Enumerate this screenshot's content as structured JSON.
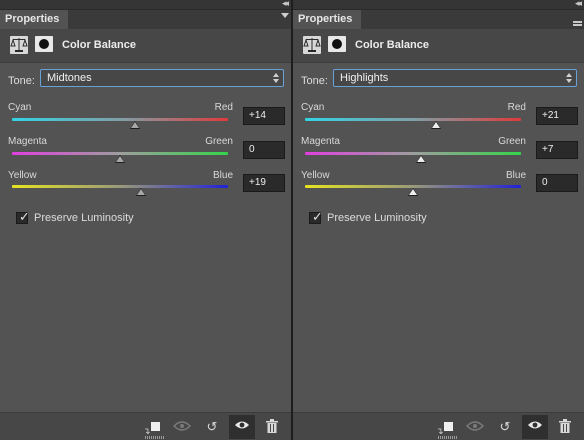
{
  "panels": [
    {
      "tab_label": "Properties",
      "collapse_glyph": "◂◂",
      "title": "Color Balance",
      "tone": {
        "label": "Tone:",
        "value": "Midtones"
      },
      "sliders": [
        {
          "left": "Cyan",
          "right": "Red",
          "value": "+14",
          "level": 14
        },
        {
          "left": "Magenta",
          "right": "Green",
          "value": "0",
          "level": 0
        },
        {
          "left": "Yellow",
          "right": "Blue",
          "value": "+19",
          "level": 19
        }
      ],
      "preserve": {
        "label": "Preserve Luminosity",
        "checked": true
      }
    },
    {
      "tab_label": "Properties",
      "collapse_glyph": "◂◂",
      "title": "Color Balance",
      "tone": {
        "label": "Tone:",
        "value": "Highlights"
      },
      "sliders": [
        {
          "left": "Cyan",
          "right": "Red",
          "value": "+21",
          "level": 21
        },
        {
          "left": "Magenta",
          "right": "Green",
          "value": "+7",
          "level": 7
        },
        {
          "left": "Yellow",
          "right": "Blue",
          "value": "0",
          "level": 0
        }
      ],
      "preserve": {
        "label": "Preserve Luminosity",
        "checked": true
      }
    }
  ],
  "slider_range": [
    -100,
    100
  ],
  "footer_icons": [
    "clip-to-layer-icon",
    "visibility-preview-icon",
    "reset-icon",
    "eye-icon",
    "trash-icon"
  ],
  "colors": {
    "panel": "#535353",
    "accent_border": "#6aa0d8",
    "cyan": "#32d4e4",
    "red": "#e03a3a",
    "magenta": "#e23fe0",
    "green": "#35d54a",
    "yellow": "#e4e422",
    "blue": "#2222d8"
  }
}
